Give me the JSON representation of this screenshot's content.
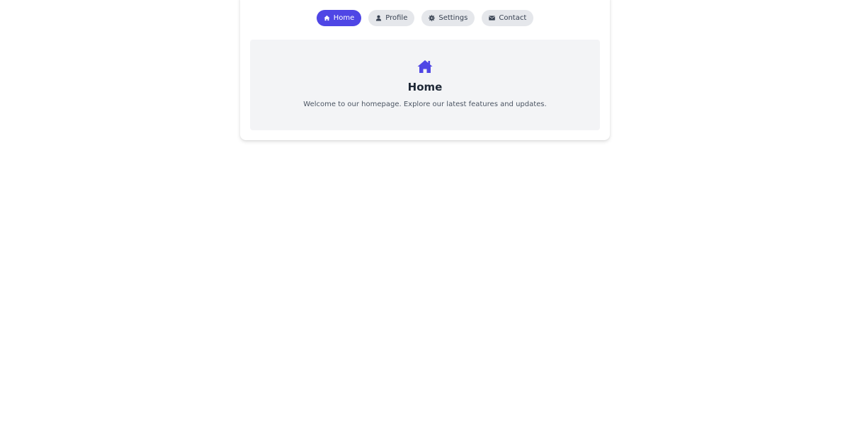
{
  "colors": {
    "accent": "#4f46e5",
    "pill_bg": "#e5e7eb",
    "panel_bg": "#f3f4f6"
  },
  "nav": {
    "items": [
      {
        "label": "Home",
        "icon": "home-icon",
        "active": true
      },
      {
        "label": "Profile",
        "icon": "user-icon",
        "active": false
      },
      {
        "label": "Settings",
        "icon": "gear-icon",
        "active": false
      },
      {
        "label": "Contact",
        "icon": "envelope-icon",
        "active": false
      }
    ]
  },
  "content": {
    "icon": "home-icon",
    "title": "Home",
    "text": "Welcome to our homepage. Explore our latest features and updates."
  }
}
